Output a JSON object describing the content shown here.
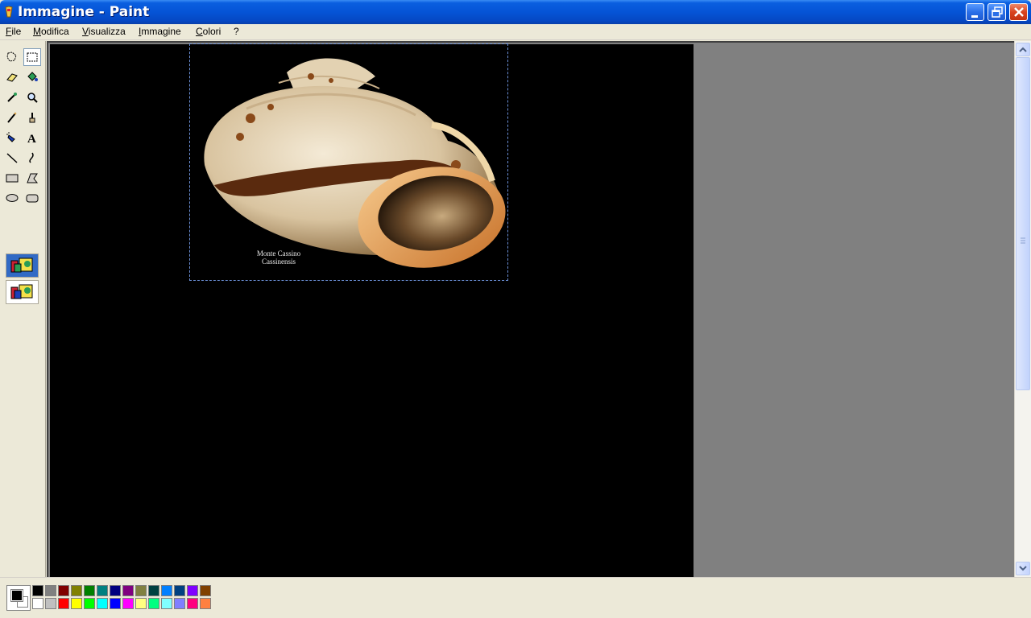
{
  "window": {
    "title": "Immagine - Paint"
  },
  "menu": [
    "File",
    "Modifica",
    "Visualizza",
    "Immagine",
    "Colori",
    "?"
  ],
  "toolbox": {
    "tools": [
      "free-form-select-icon",
      "rectangle-select-icon",
      "eraser-icon",
      "fill-bucket-icon",
      "color-picker-icon",
      "magnifier-icon",
      "pencil-icon",
      "brush-icon",
      "airbrush-icon",
      "text-icon",
      "line-icon",
      "curve-icon",
      "rectangle-icon",
      "polygon-icon",
      "ellipse-icon",
      "rounded-rectangle-icon"
    ],
    "selected_tool": "rectangle-select-icon"
  },
  "canvas": {
    "caption_line1": "Monte Cassino",
    "caption_line2": "Cassinensis"
  },
  "palette": {
    "foreground": "#000000",
    "background": "#ffffff",
    "row1": [
      "#000000",
      "#808080",
      "#800000",
      "#808000",
      "#008000",
      "#008080",
      "#000080",
      "#800080",
      "#808040",
      "#004040",
      "#0080ff",
      "#004080",
      "#8000ff",
      "#804000"
    ],
    "row2": [
      "#ffffff",
      "#c0c0c0",
      "#ff0000",
      "#ffff00",
      "#00ff00",
      "#00ffff",
      "#0000ff",
      "#ff00ff",
      "#ffff80",
      "#00ff80",
      "#80ffff",
      "#8080ff",
      "#ff0080",
      "#ff8040"
    ]
  }
}
